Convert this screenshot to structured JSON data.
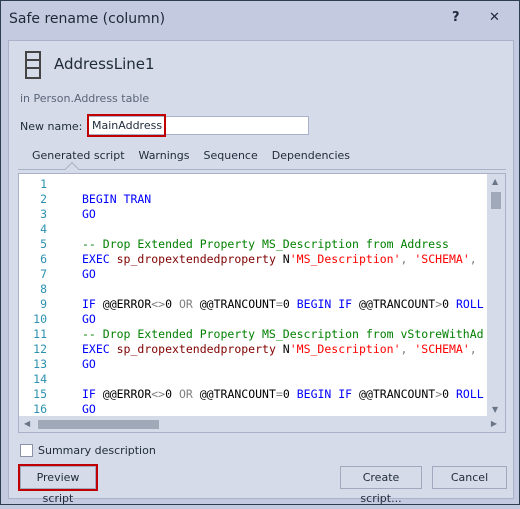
{
  "window": {
    "title": "Safe rename (column)",
    "help_label": "?",
    "close_label": "✕"
  },
  "object": {
    "icon": "table-column-icon",
    "name": "AddressLine1",
    "context": "in Person.Address table"
  },
  "rename": {
    "label": "New name:",
    "value": "MainAddress"
  },
  "tabs": [
    {
      "label": "Generated script",
      "active": true
    },
    {
      "label": "Warnings"
    },
    {
      "label": "Sequence"
    },
    {
      "label": "Dependencies"
    }
  ],
  "script": {
    "lines": [
      {
        "n": "1",
        "tokens": []
      },
      {
        "n": "2",
        "tokens": [
          [
            "kw",
            "BEGIN TRAN"
          ]
        ]
      },
      {
        "n": "3",
        "tokens": [
          [
            "kw",
            "GO"
          ]
        ]
      },
      {
        "n": "4",
        "tokens": []
      },
      {
        "n": "5",
        "tokens": [
          [
            "cm",
            "-- Drop Extended Property MS_Description from Address"
          ]
        ]
      },
      {
        "n": "6",
        "tokens": [
          [
            "kw",
            "EXEC "
          ],
          [
            "fn",
            "sp_dropextendedproperty "
          ],
          [
            "id",
            "N"
          ],
          [
            "st",
            "'MS_Description'"
          ],
          [
            "op",
            ", "
          ],
          [
            "st",
            "'SCHEMA'"
          ],
          [
            "op",
            ","
          ]
        ]
      },
      {
        "n": "7",
        "tokens": [
          [
            "kw",
            "GO"
          ]
        ]
      },
      {
        "n": "8",
        "tokens": []
      },
      {
        "n": "9",
        "tokens": [
          [
            "kw",
            "IF "
          ],
          [
            "id",
            "@@ERROR"
          ],
          [
            "op",
            "<>"
          ],
          [
            "id",
            "0 "
          ],
          [
            "op",
            "OR "
          ],
          [
            "id",
            "@@TRANCOUNT"
          ],
          [
            "op",
            "="
          ],
          [
            "id",
            "0 "
          ],
          [
            "kw",
            "BEGIN IF "
          ],
          [
            "id",
            "@@TRANCOUNT"
          ],
          [
            "op",
            ">"
          ],
          [
            "id",
            "0 "
          ],
          [
            "kw",
            "ROLL"
          ]
        ]
      },
      {
        "n": "10",
        "tokens": [
          [
            "kw",
            "GO"
          ]
        ]
      },
      {
        "n": "11",
        "tokens": [
          [
            "cm",
            "-- Drop Extended Property MS_Description from vStoreWithAd"
          ]
        ]
      },
      {
        "n": "12",
        "tokens": [
          [
            "kw",
            "EXEC "
          ],
          [
            "fn",
            "sp_dropextendedproperty "
          ],
          [
            "id",
            "N"
          ],
          [
            "st",
            "'MS_Description'"
          ],
          [
            "op",
            ", "
          ],
          [
            "st",
            "'SCHEMA'"
          ],
          [
            "op",
            ","
          ]
        ]
      },
      {
        "n": "13",
        "tokens": [
          [
            "kw",
            "GO"
          ]
        ]
      },
      {
        "n": "14",
        "tokens": []
      },
      {
        "n": "15",
        "tokens": [
          [
            "kw",
            "IF "
          ],
          [
            "id",
            "@@ERROR"
          ],
          [
            "op",
            "<>"
          ],
          [
            "id",
            "0 "
          ],
          [
            "op",
            "OR "
          ],
          [
            "id",
            "@@TRANCOUNT"
          ],
          [
            "op",
            "="
          ],
          [
            "id",
            "0 "
          ],
          [
            "kw",
            "BEGIN IF "
          ],
          [
            "id",
            "@@TRANCOUNT"
          ],
          [
            "op",
            ">"
          ],
          [
            "id",
            "0 "
          ],
          [
            "kw",
            "ROLL"
          ]
        ]
      },
      {
        "n": "16",
        "tokens": [
          [
            "kw",
            "GO"
          ]
        ]
      }
    ]
  },
  "summary": {
    "label": "Summary description",
    "checked": false
  },
  "buttons": {
    "preview": "Preview script",
    "create": "Create script...",
    "cancel": "Cancel"
  },
  "colors": {
    "highlight": "#c00000",
    "keyword": "#0000ff",
    "comment": "#008000",
    "string": "#ff0000",
    "line_number": "#2b91af"
  }
}
